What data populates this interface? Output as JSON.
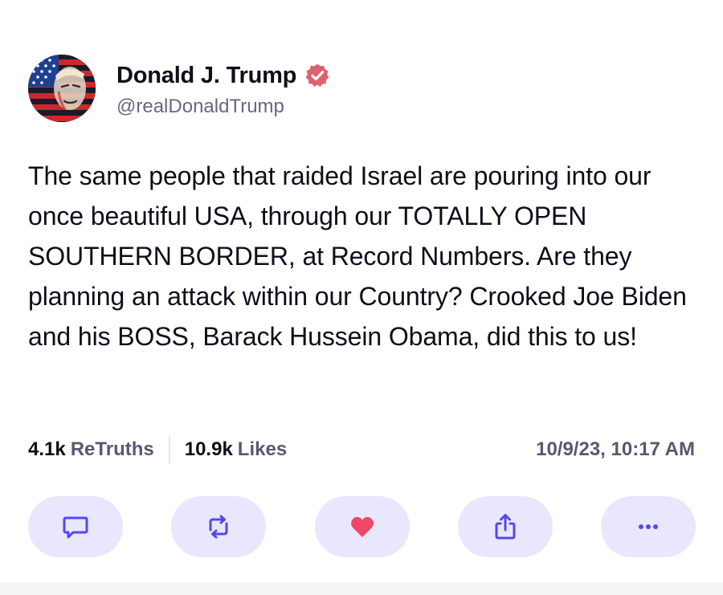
{
  "author": {
    "display_name": "Donald J. Trump",
    "handle": "@realDonaldTrump",
    "verified_icon": "verified-badge-icon",
    "avatar_icon": "flag-portrait-avatar"
  },
  "post": {
    "text": "The same people that raided Israel are pouring into our once beautiful USA, through our TOTALLY OPEN SOUTHERN BORDER, at Record Numbers. Are they planning an attack within our Country? Crooked Joe Biden and his BOSS, Barack Hussein Obama, did this to us!"
  },
  "stats": {
    "retruths_count": "4.1k",
    "retruths_label": "ReTruths",
    "likes_count": "10.9k",
    "likes_label": "Likes",
    "timestamp": "10/9/23, 10:17 AM"
  },
  "actions": [
    {
      "icon": "reply-icon"
    },
    {
      "icon": "retruth-icon"
    },
    {
      "icon": "heart-icon"
    },
    {
      "icon": "share-icon"
    },
    {
      "icon": "more-icon"
    }
  ],
  "colors": {
    "accent": "#5448ee",
    "button_bg": "#e8e7fd",
    "like": "#ee4768",
    "verified": "#e05f6f",
    "muted_text": "#585872",
    "text": "#0e0e1a"
  }
}
